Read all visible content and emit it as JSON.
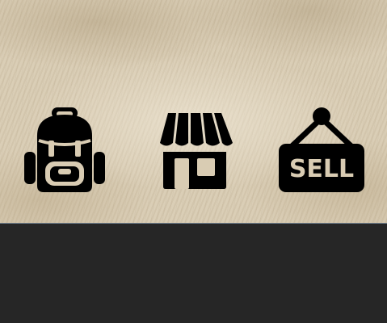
{
  "colors": {
    "banner_background": "#d8cbb2",
    "icon_color": "#000000",
    "icon_cutout": "#d9ccb3",
    "footer_background": "#262626",
    "divider": "#6f7f8d"
  },
  "icons": [
    {
      "name": "backpack-icon"
    },
    {
      "name": "store-icon"
    },
    {
      "name": "sell-sign-icon",
      "text": "SELL"
    }
  ]
}
